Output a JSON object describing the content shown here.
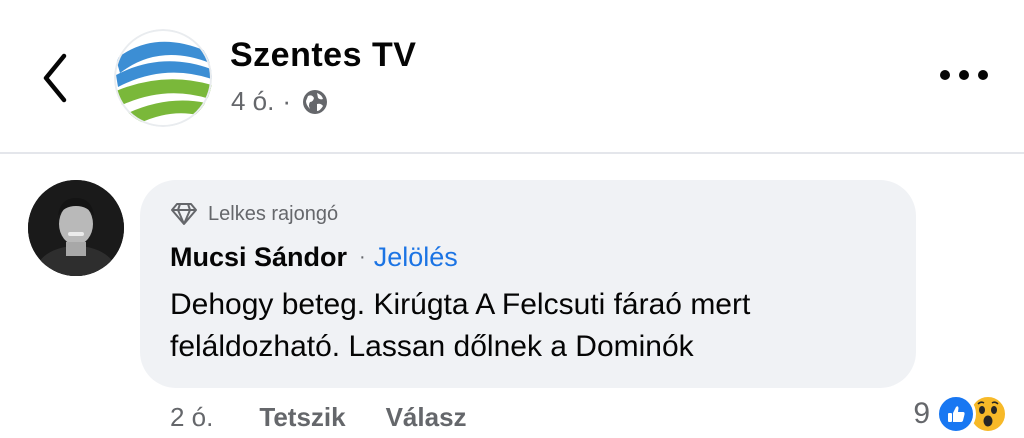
{
  "header": {
    "page_name": "Szentes TV",
    "time": "4 ó.",
    "dot": "·",
    "icons": {
      "back": "chevron-left-icon",
      "privacy": "globe-icon",
      "more": "more-horizontal-icon"
    }
  },
  "comment": {
    "badge": "Lelkes rajongó",
    "author": "Mucsi Sándor",
    "separator": "·",
    "follow_label": "Jelölés",
    "text": "Dehogy beteg. Kirúgta A Felcsuti fáraó mert feláldozható. Lassan dőlnek a Dominók",
    "time": "2 ó.",
    "like_label": "Tetszik",
    "reply_label": "Válasz",
    "reaction_count": "9",
    "reactions": [
      "like",
      "wow"
    ]
  },
  "colors": {
    "link": "#1b74e4",
    "bubble": "#f0f2f5",
    "secondary_text": "#65676b",
    "like": "#1877f2",
    "wow": "#f7b928"
  }
}
